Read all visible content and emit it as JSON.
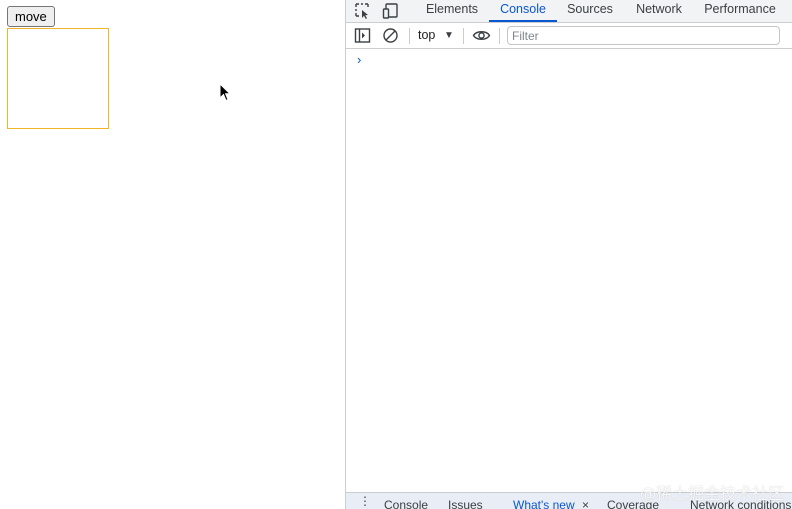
{
  "page": {
    "move_button_label": "move"
  },
  "devtools": {
    "tabs": [
      {
        "label": "Elements"
      },
      {
        "label": "Console",
        "active": true
      },
      {
        "label": "Sources"
      },
      {
        "label": "Network"
      },
      {
        "label": "Performance"
      }
    ],
    "toolbar": {
      "context_label": "top",
      "filter_placeholder": "Filter"
    },
    "console": {
      "prompt_symbol": "›"
    },
    "drawer": {
      "menu_symbol": "⋮",
      "tabs": [
        {
          "label": "Console"
        },
        {
          "label": "Issues"
        },
        {
          "label": "What's new",
          "active": true
        },
        {
          "label": "Coverage"
        },
        {
          "label": "Network conditions"
        }
      ],
      "close_symbol": "×"
    },
    "accent_color": "#0b57d0"
  },
  "watermark": "@稀土掘金技术社区"
}
